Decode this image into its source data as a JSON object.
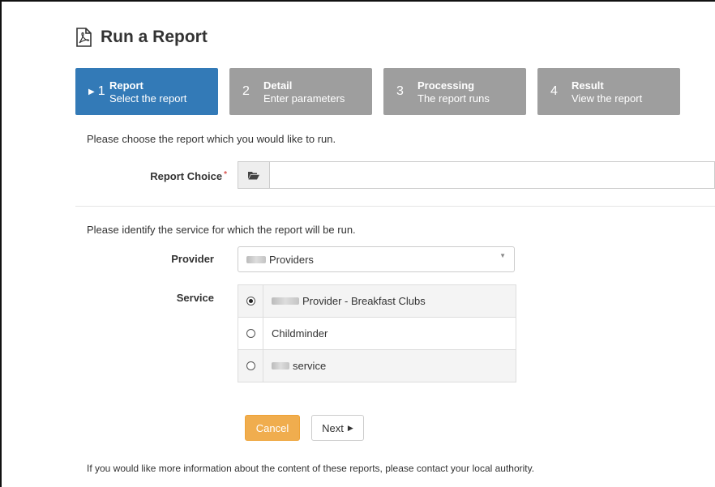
{
  "page": {
    "title": "Run a Report",
    "icon": "pdf-file-icon"
  },
  "steps": [
    {
      "number": "1",
      "name": "Report",
      "sub": "Select the report",
      "active": true
    },
    {
      "number": "2",
      "name": "Detail",
      "sub": "Enter parameters",
      "active": false
    },
    {
      "number": "3",
      "name": "Processing",
      "sub": "The report runs",
      "active": false
    },
    {
      "number": "4",
      "name": "Result",
      "sub": "View the report",
      "active": false
    }
  ],
  "report": {
    "intro": "Please choose the report which you would like to run.",
    "choice_label": "Report Choice",
    "required_mark": "*",
    "folder_icon": "folder-open-icon",
    "value": ""
  },
  "service_section": {
    "intro": "Please identify the service for which the report will be run.",
    "provider_label": "Provider",
    "provider_value": "Providers",
    "service_label": "Service",
    "options": [
      {
        "label": "Provider - Breakfast Clubs",
        "selected": true
      },
      {
        "label": "Childminder",
        "selected": false
      },
      {
        "label": "service",
        "selected": false
      }
    ]
  },
  "buttons": {
    "cancel": "Cancel",
    "next": "Next"
  },
  "footer": "If you would like more information about the content of these reports, please contact your local authority.",
  "colors": {
    "primary": "#337ab7",
    "inactive_step": "#9e9e9e",
    "warning": "#f0ad4e",
    "required": "#d9534f"
  }
}
